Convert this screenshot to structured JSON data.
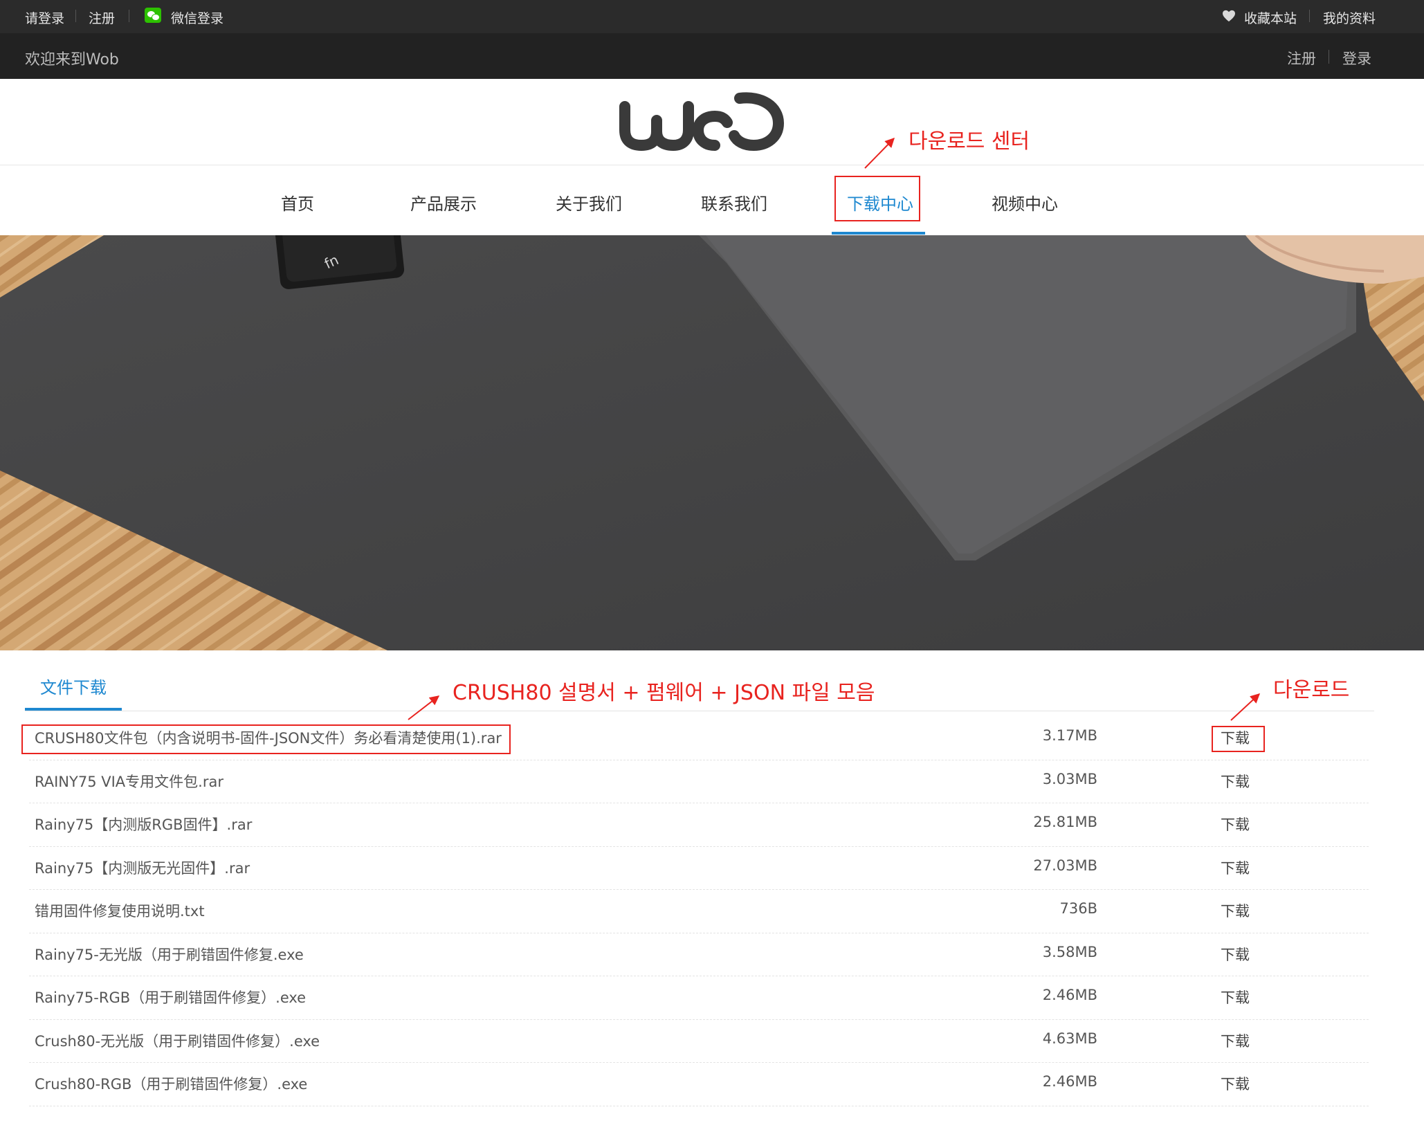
{
  "topbar": {
    "login": "请登录",
    "register": "注册",
    "wechat_login": "微信登录",
    "bookmark": "收藏本站",
    "my_profile": "我的资料"
  },
  "welcome_bar": {
    "welcome": "欢迎来到Wob",
    "register": "注册",
    "login": "登录"
  },
  "logo": {
    "text": "wob"
  },
  "nav": {
    "items": [
      {
        "label": "首页"
      },
      {
        "label": "产品展示"
      },
      {
        "label": "关于我们"
      },
      {
        "label": "联系我们"
      },
      {
        "label": "下载中心",
        "active": true
      },
      {
        "label": "视频中心"
      }
    ]
  },
  "downloads": {
    "tab": "文件下载",
    "files": [
      {
        "name": "CRUSH80文件包（内含说明书-固件-JSON文件）务必看清楚使用(1).rar",
        "size": "3.17MB",
        "action": "下载"
      },
      {
        "name": "RAINY75 VIA专用文件包.rar",
        "size": "3.03MB",
        "action": "下载"
      },
      {
        "name": "Rainy75【内测版RGB固件】.rar",
        "size": "25.81MB",
        "action": "下载"
      },
      {
        "name": "Rainy75【内测版无光固件】.rar",
        "size": "27.03MB",
        "action": "下载"
      },
      {
        "name": "错用固件修复使用说明.txt",
        "size": "736B",
        "action": "下载"
      },
      {
        "name": "Rainy75-无光版（用于刷错固件修复.exe",
        "size": "3.58MB",
        "action": "下载"
      },
      {
        "name": "Rainy75-RGB（用于刷错固件修复）.exe",
        "size": "2.46MB",
        "action": "下载"
      },
      {
        "name": "Crush80-无光版（用于刷错固件修复）.exe",
        "size": "4.63MB",
        "action": "下载"
      },
      {
        "name": "Crush80-RGB（用于刷错固件修复）.exe",
        "size": "2.46MB",
        "action": "下载"
      }
    ]
  },
  "annotations": {
    "nav_note": "다운로드 센터",
    "file_note": "CRUSH80 설명서 + 펌웨어 + JSON 파일 모음",
    "download_note": "다운로드",
    "color": "#e8231f"
  },
  "colors": {
    "accent": "#1e88d0",
    "topbar": "#2b2b2b",
    "welcome_bar": "#222222"
  }
}
